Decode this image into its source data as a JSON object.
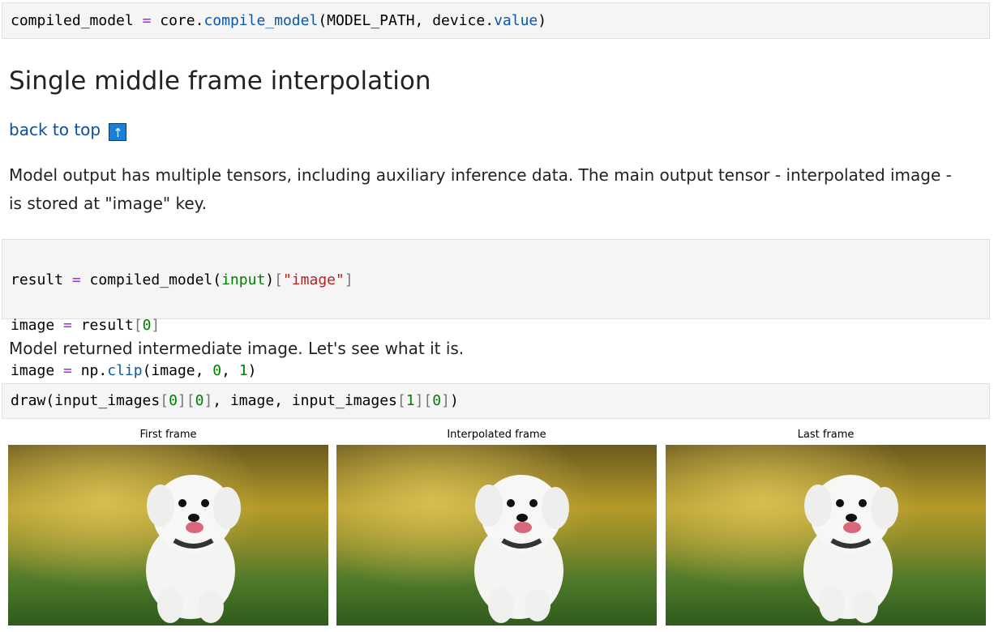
{
  "code_cells": {
    "compile": {
      "t1": "compiled_model ",
      "op1": "=",
      "t2": " core.",
      "fn1": "compile_model",
      "t3": "(MODEL_PATH, device.",
      "fn2": "value",
      "t4": ")"
    },
    "infer": {
      "l1": {
        "t1": "result ",
        "op": "=",
        "t2": " compiled_model(",
        "nm": "input",
        "t3": ")",
        "b1": "[",
        "st": "\"image\"",
        "b2": "]"
      },
      "l2": {
        "t1": "image ",
        "op": "=",
        "t2": " result",
        "b1": "[",
        "nm": "0",
        "b2": "]"
      },
      "l3": {
        "t1": "image ",
        "op": "=",
        "t2": " np.",
        "fn": "clip",
        "t3": "(image, ",
        "n1": "0",
        "t4": ", ",
        "n2": "1",
        "t5": ")"
      }
    },
    "draw": {
      "t1": "draw(input_images",
      "b1": "[",
      "n1": "0",
      "b2": "][",
      "n2": "0",
      "b3": "]",
      "t2": ", image, input_images",
      "b4": "[",
      "n3": "1",
      "b5": "][",
      "n4": "0",
      "b6": "]",
      "t3": ")"
    }
  },
  "heading": "Single middle frame interpolation",
  "back_to_top": {
    "label": "back to top",
    "icon": "up-arrow-icon",
    "glyph": "↑"
  },
  "paragraph1": {
    "line1": "Model output has multiple tensors, including auxiliary inference data. The main output tensor - interpolated image -",
    "line2": "is stored at \"image\" key."
  },
  "paragraph2": "Model returned intermediate image. Let's see what it is.",
  "figure": {
    "captions": [
      "First frame",
      "Interpolated frame",
      "Last frame"
    ],
    "scene": "white puppy running on grass"
  },
  "colors": {
    "link": "#0b4fa0",
    "code_bg": "#f5f5f5",
    "keyword_op": "#aa22ff",
    "func": "#0a57a6",
    "number": "#008000",
    "string": "#ba2121"
  }
}
